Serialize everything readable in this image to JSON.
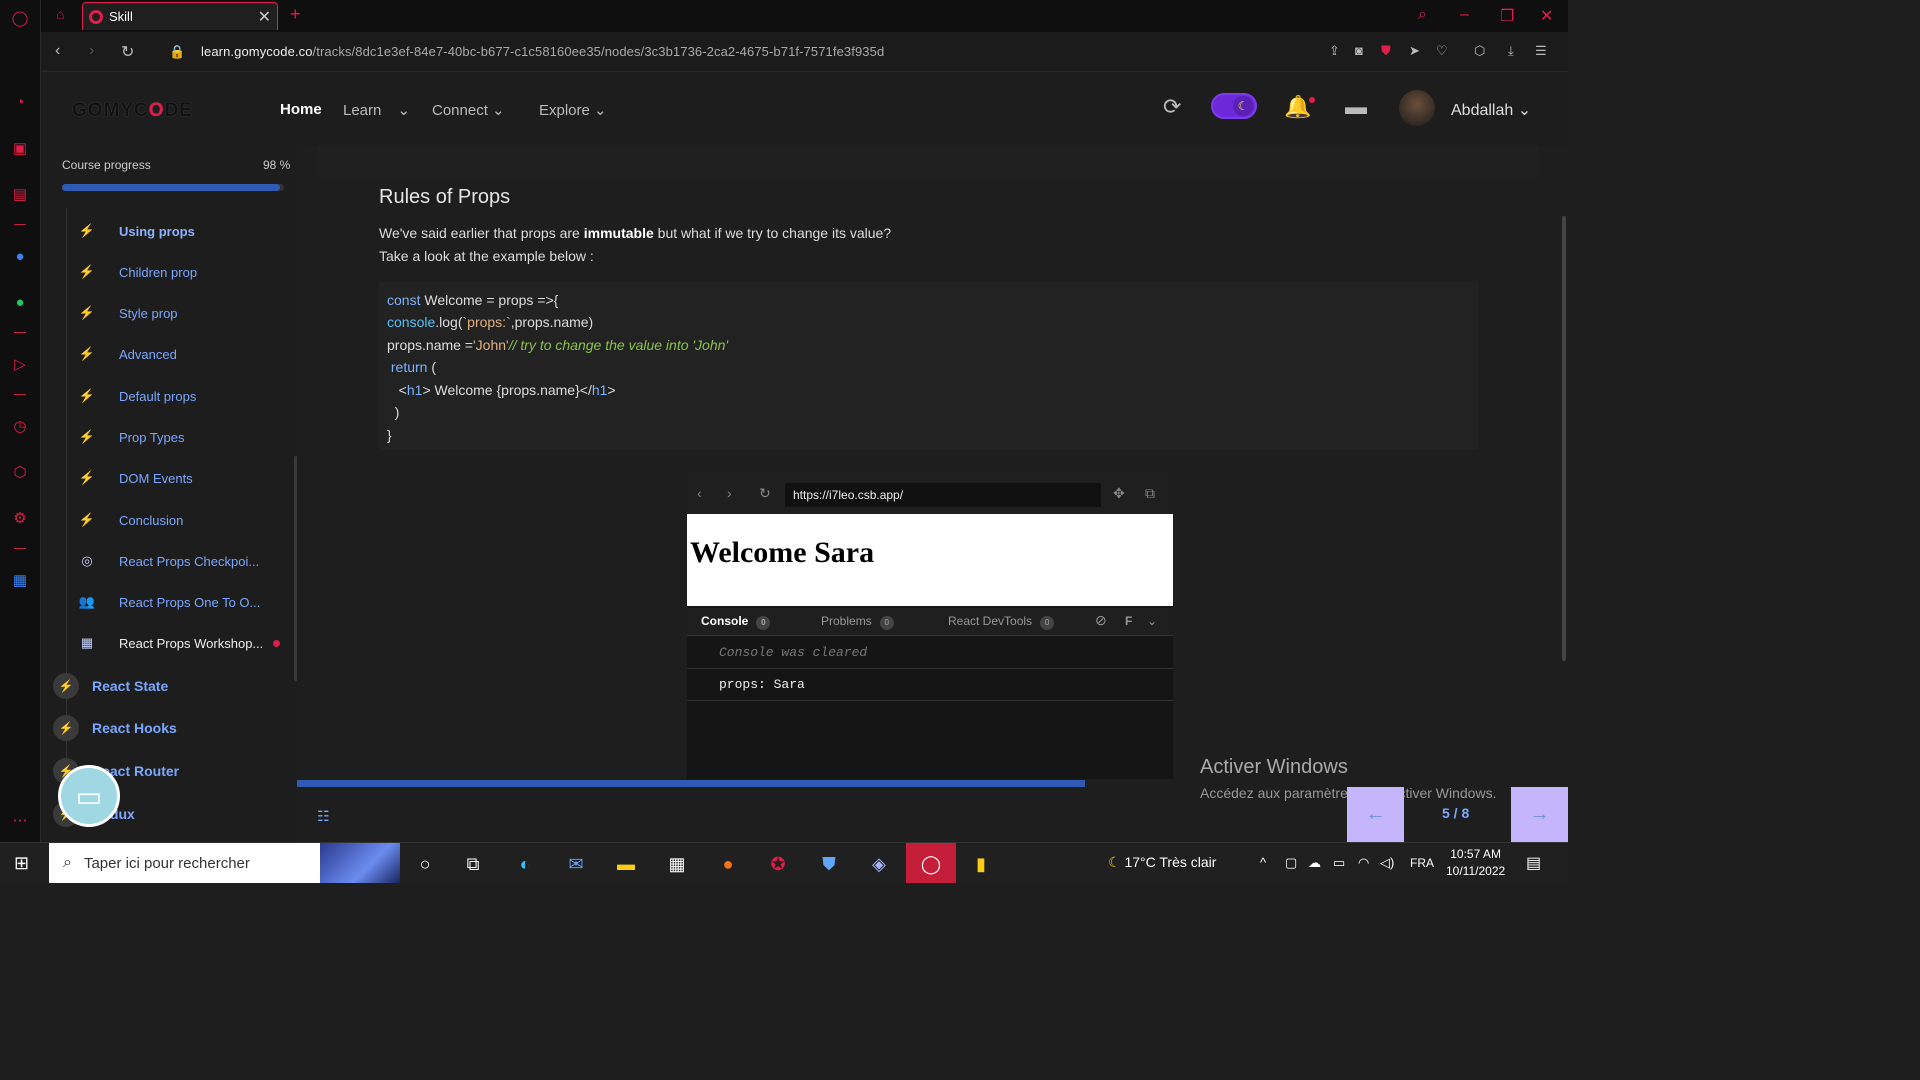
{
  "browser": {
    "tab_title": "Skill",
    "url_domain": "learn.gomycode.co",
    "url_path": "/tracks/8dc1e3ef-84e7-40bc-b677-c1c58160ee35/nodes/3c3b1736-2ca2-4675-b71f-7571fe3f935d"
  },
  "header": {
    "logo_a": "GOMYC",
    "logo_b": "O",
    "logo_c": "DE",
    "nav": [
      "Home",
      "Learn",
      "Connect",
      "Explore"
    ],
    "username": "Abdallah"
  },
  "sidebar": {
    "progress_label": "Course progress",
    "progress_value": "98 %",
    "progress_fraction": 0.98,
    "lessons": [
      {
        "label": "Using props",
        "icon": "bolt-icon"
      },
      {
        "label": "Children prop",
        "icon": "bolt-icon"
      },
      {
        "label": "Style prop",
        "icon": "bolt-icon"
      },
      {
        "label": "Advanced",
        "icon": "bolt-icon"
      },
      {
        "label": "Default props",
        "icon": "bolt-icon"
      },
      {
        "label": "Prop Types",
        "icon": "bolt-icon"
      },
      {
        "label": "DOM Events",
        "icon": "bolt-icon"
      },
      {
        "label": "Conclusion",
        "icon": "bolt-icon"
      },
      {
        "label": "React Props Checkpoi...",
        "icon": "target-icon"
      },
      {
        "label": "React Props One To O...",
        "icon": "people-icon"
      },
      {
        "label": "React Props Workshop...",
        "icon": "workshop-icon"
      }
    ],
    "modules": [
      "React State",
      "React Hooks",
      "React Router",
      "Redux"
    ]
  },
  "content": {
    "heading": "Rules of Props",
    "para1_a": "We've said earlier that props are ",
    "para1_b": "immutable",
    "para1_c": " but what if we try to change its value?",
    "para2": "Take a look at the example below :",
    "code": {
      "l1_kw": "const",
      "l1_rest": " Welcome = props =>{",
      "l2_fn": "console",
      "l2_rest": ".log(",
      "l2_str": "`props:`",
      "l2_tail": ",props.name)",
      "l3_a": "props.name =",
      "l3_str": "'John'",
      "l3_cm": "// try to change the value into 'John'",
      "l4_kw": " return",
      "l4_rest": " (",
      "l5_pre": "   <",
      "l5_tag": "h1",
      "l5_mid": "> Welcome {props.name}</",
      "l5_tag2": "h1",
      "l5_end": ">",
      "l6": "  )",
      "l7": "}"
    },
    "sandbox": {
      "url": "https://i7leo.csb.app/",
      "page_heading": "Welcome Sara",
      "tabs": [
        "Console",
        "Problems",
        "React DevTools"
      ],
      "tab_counts": [
        "0",
        "0",
        "0"
      ],
      "filter_label": "F",
      "console_cleared": "Console was cleared",
      "console_log": "props:  Sara"
    },
    "slide_progress_fraction": 0.62,
    "pager": {
      "count": "5 / 8",
      "prev": "←",
      "next": "→"
    },
    "activate_title": "Activer Windows",
    "activate_sub": "Accédez aux paramètres pour activer Windows."
  },
  "taskbar": {
    "search_placeholder": "Taper ici pour rechercher",
    "weather": "17°C  Très clair",
    "lang": "FRA",
    "time": "10:57 AM",
    "date": "10/11/2022"
  }
}
